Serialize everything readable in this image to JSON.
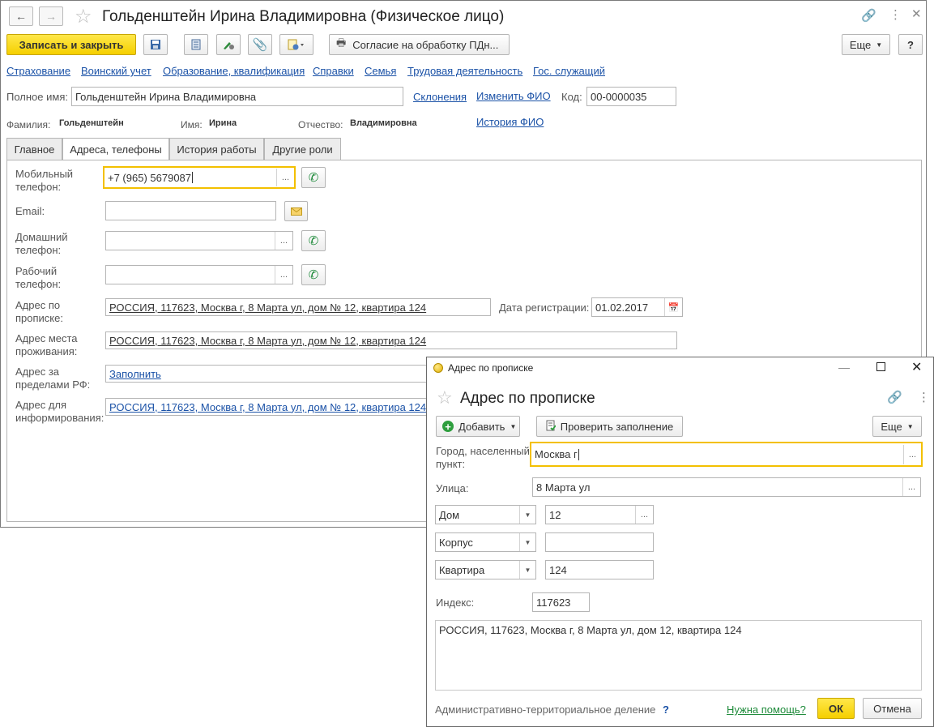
{
  "window": {
    "title": "Гольденштейн Ирина Владимировна (Физическое лицо)"
  },
  "toolbar": {
    "save_close": "Записать и закрыть",
    "consent": "Согласие на обработку ПДн...",
    "more": "Еще",
    "help": "?"
  },
  "links": [
    "Страхование",
    "Воинский учет",
    "Образование, квалификация",
    "Справки",
    "Семья",
    "Трудовая деятельность",
    "Гос. служащий"
  ],
  "person": {
    "full_name_label": "Полное имя:",
    "full_name": "Гольденштейн Ирина Владимировна",
    "declensions": "Склонения",
    "change_fio": "Изменить ФИО",
    "code_label": "Код:",
    "code": "00-0000035",
    "surname_label": "Фамилия:",
    "surname": "Гольденштейн",
    "name_label": "Имя:",
    "name": "Ирина",
    "patronymic_label": "Отчество:",
    "patronymic": "Владимировна",
    "history_fio": "История ФИО"
  },
  "tabs": [
    "Главное",
    "Адреса, телефоны",
    "История работы",
    "Другие роли"
  ],
  "contacts": {
    "mobile_label1": "Мобильный",
    "mobile_label2": "телефон:",
    "mobile": "+7 (965) 5679087",
    "email_label": "Email:",
    "email": "",
    "home_label1": "Домашний",
    "home_label2": "телефон:",
    "home": "",
    "work_label1": "Рабочий",
    "work_label2": "телефон:",
    "work": "",
    "reg_label1": "Адрес по",
    "reg_label2": "прописке:",
    "reg_address": "РОССИЯ, 117623, Москва г, 8 Марта ул, дом № 12, квартира 124",
    "reg_date_label": "Дата регистрации:",
    "reg_date": "01.02.2017",
    "live_label1": "Адрес места",
    "live_label2": "проживания:",
    "live_address": "РОССИЯ, 117623, Москва г, 8 Марта ул, дом № 12, квартира 124",
    "abroad_label1": "Адрес за",
    "abroad_label2": "пределами РФ:",
    "abroad_fill": "Заполнить",
    "info_label1": "Адрес для",
    "info_label2": "информирования:",
    "info_address": "РОССИЯ, 117623, Москва г, 8 Марта ул, дом № 12, квартира 124"
  },
  "dialog": {
    "window_title": "Адрес по прописке",
    "title": "Адрес по прописке",
    "add": "Добавить",
    "check": "Проверить заполнение",
    "more": "Еще",
    "city_label1": "Город, населенный",
    "city_label2": "пункт:",
    "city": "Москва г",
    "street_label": "Улица:",
    "street": "8 Марта ул",
    "house_type": "Дом",
    "house": "12",
    "building_type": "Корпус",
    "building": "",
    "apartment_type": "Квартира",
    "apartment": "124",
    "index_label": "Индекс:",
    "index": "117623",
    "full_address": "РОССИЯ, 117623, Москва г, 8 Марта ул, дом 12, квартира 124",
    "admin_division": "Административно-территориальное деление",
    "admin_q": "?",
    "need_help": "Нужна помощь?",
    "ok": "ОК",
    "cancel": "Отмена"
  },
  "colors": {
    "accent_yellow": "#f5cf00",
    "link_blue": "#1b52a7",
    "link_green": "#1f8b3b",
    "phone_green": "#1e8a3a"
  }
}
